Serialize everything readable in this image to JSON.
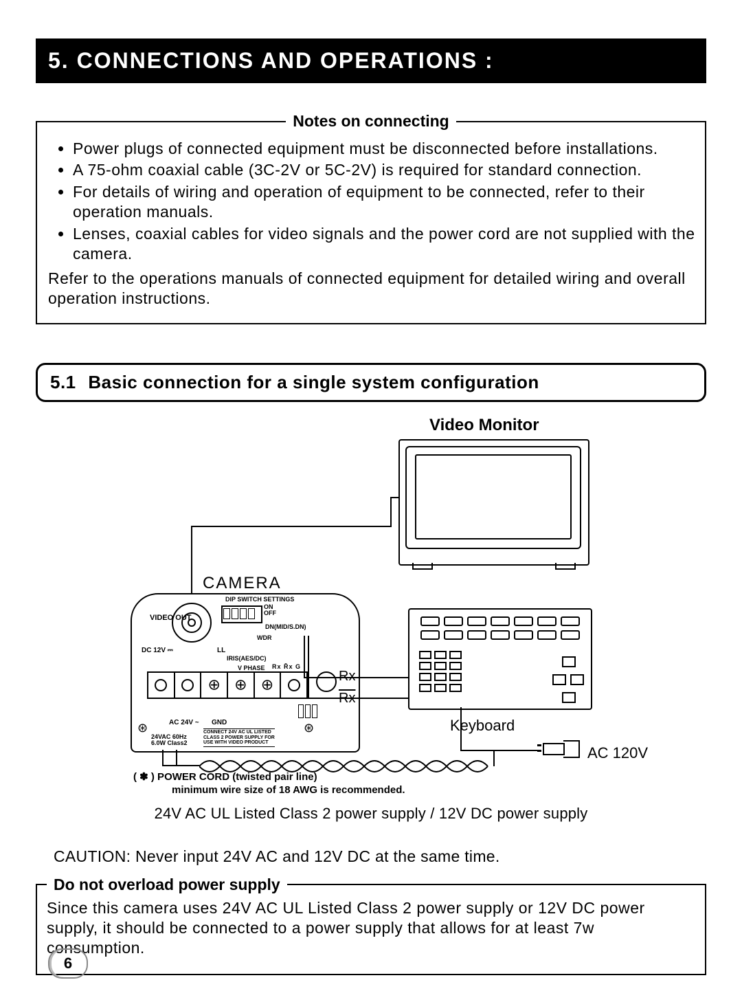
{
  "page_number": "6",
  "section": {
    "number": "5.",
    "title": "CONNECTIONS AND OPERATIONS :"
  },
  "notes_box": {
    "legend": "Notes on connecting",
    "bullets": [
      "Power plugs of connected equipment must be disconnected before installations.",
      "A 75-ohm coaxial cable (3C-2V or 5C-2V) is required for standard connection.",
      "For details of wiring and operation of equipment to be connected, refer to their operation manuals.",
      "Lenses, coaxial cables for video signals and the power cord are not supplied with the camera."
    ],
    "after": "Refer to the operations manuals of connected equipment for detailed wiring and overall operation instructions."
  },
  "subsection": {
    "number": "5.1",
    "title": "Basic connection for a single system configuration"
  },
  "diagram": {
    "video_monitor": "Video Monitor",
    "camera": "CAMERA",
    "keyboard": "Keyboard",
    "ac120": "AC 120V",
    "rx": "Rx",
    "rx_bar": "Rx",
    "power_cord": "( ✽ ) POWER CORD (twisted pair line)",
    "awg_note": "minimum wire size of 18 AWG is recommended.",
    "camera_labels": {
      "video_out": "VIDEO OUT",
      "dip": "DIP SWITCH SETTINGS",
      "onoff": "ON\nOFF",
      "dn": "DN(MID/S.DN)",
      "wdr": "WDR",
      "dc12": "DC 12V ⎓",
      "pm": "−    +",
      "ll": "LL",
      "iris": "IRIS(AES/DC)",
      "vphase": "V PHASE",
      "rxg": "Rx R̄x G",
      "ac24": "AC 24V ~",
      "gnd": "GND",
      "rating": "24VAC 60Hz\n6.0W Class2",
      "rating_box": "CONNECT 24V AC UL LISTED\nCLASS 2 POWER SUPPLY FOR\nUSE WITH VIDEO PRODUCT"
    }
  },
  "psu_line": "24V AC UL Listed Class 2 power supply / 12V DC power supply",
  "caution": "CAUTION: Never input 24V AC and 12V DC at the same time.",
  "warn_box": {
    "legend": "Do not overload power supply",
    "text": "Since this camera uses 24V AC UL Listed Class 2 power supply or 12V DC power supply, it should be connected to a power supply that allows for at least 7w consumption."
  }
}
